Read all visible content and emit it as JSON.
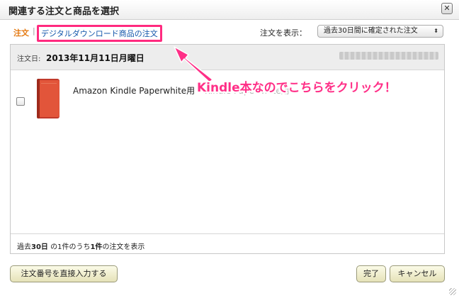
{
  "dialog": {
    "title": "関連する注文と商品を選択",
    "close_label": "✕"
  },
  "tabs": {
    "orders_label": "注文",
    "separator": "|",
    "digital_label": "デジタルダウンロード商品の注文"
  },
  "filter": {
    "label": "注文を表示：",
    "selected": "過去30日間に確定された注文",
    "arrow": "⬍"
  },
  "order": {
    "date_label": "注文日:",
    "date_value": "2013年11月11日月曜日",
    "item": {
      "title": "Amazon Kindle Paperwhite用",
      "title_ghost": "Kindle Paperwhite用",
      "cover_color": "#e2553a"
    }
  },
  "annotation": {
    "text": "Kindle本なのでこちらをクリック！",
    "color": "#ff2f87"
  },
  "summary": {
    "prefix": "過去",
    "days": "30日",
    "middle": " の1件のうち",
    "count": "1件",
    "suffix": "の注文を表示"
  },
  "buttons": {
    "manual_entry": "注文番号を直接入力する",
    "done": "完了",
    "cancel": "キャンセル"
  }
}
